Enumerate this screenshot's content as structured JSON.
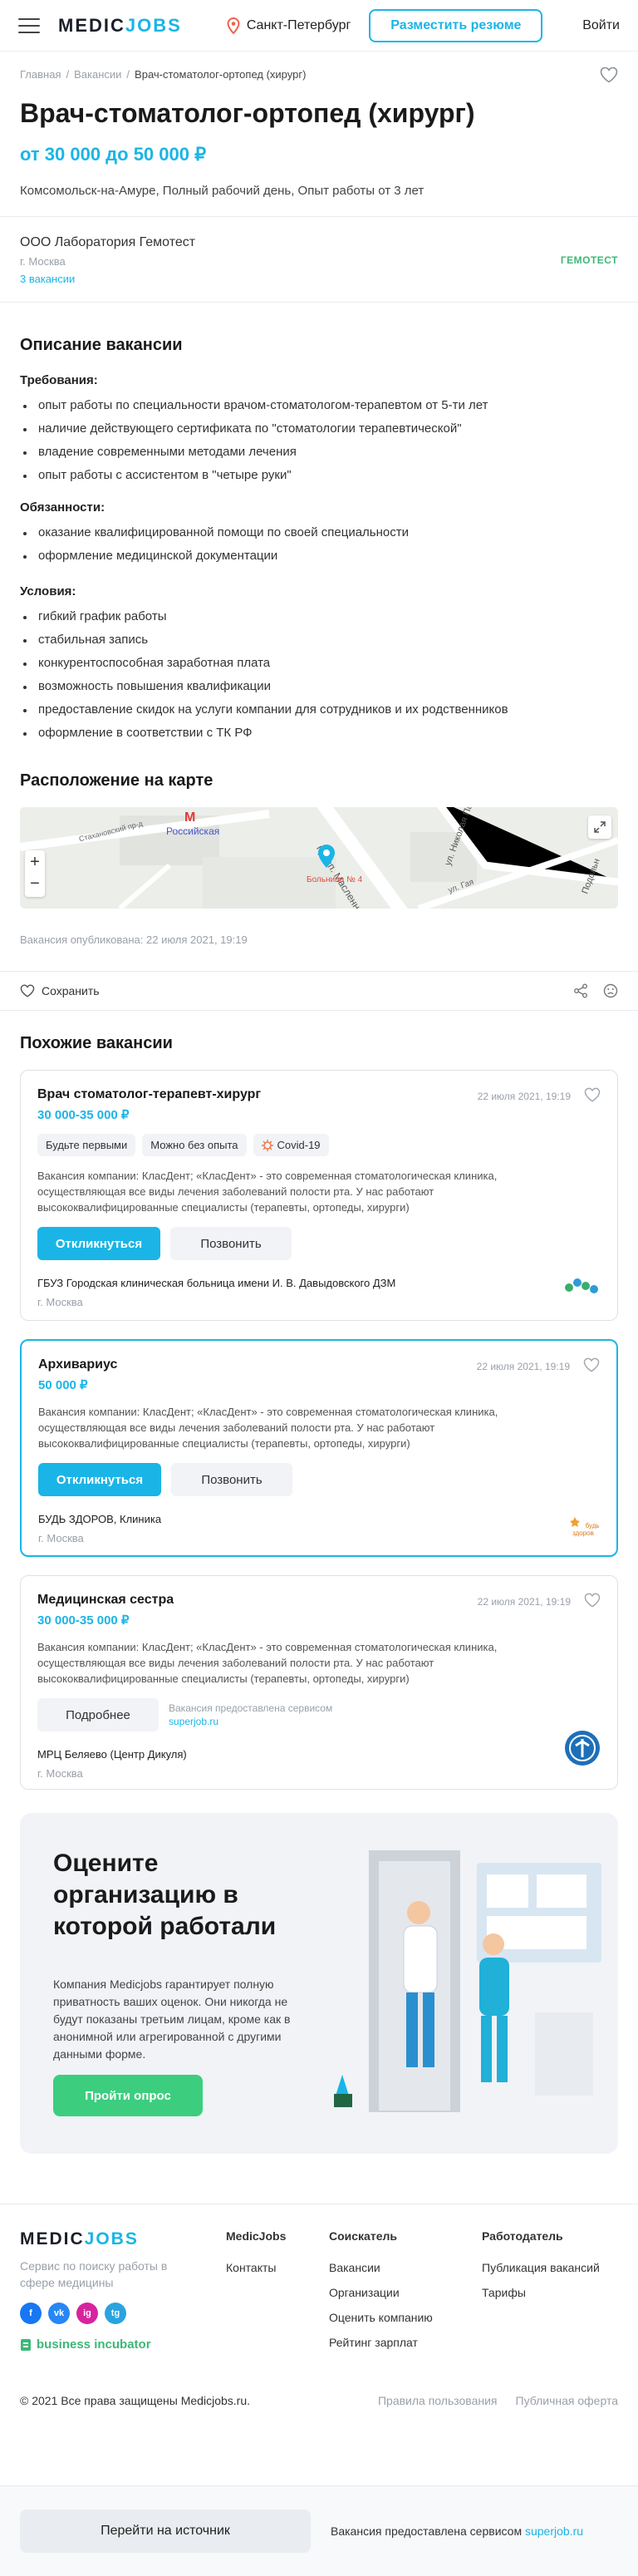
{
  "header": {
    "logo_a": "MEDIC",
    "logo_b": "JOBS",
    "city": "Санкт-Петербург",
    "resume_btn": "Разместить резюме",
    "login": "Войти"
  },
  "breadcrumbs": [
    "Главная",
    "Вакансии",
    "Врач-стоматолог-ортопед (хирург)"
  ],
  "vacancy": {
    "title": "Врач-стоматолог-ортопед (хирург)",
    "salary": "от 30 000 до 50 000 ₽",
    "meta": "Комсомольск-на-Амуре, Полный рабочий день, Опыт работы от 3 лет"
  },
  "company": {
    "name": "ООО Лаборатория Гемотест",
    "city": "г. Москва",
    "count": "3 вакансии",
    "logo_text": "ГЕМОТЕСТ"
  },
  "description": {
    "heading": "Описание вакансии",
    "req_heading": "Требования:",
    "requirements": [
      "опыт работы по специальности врачом-стоматологом-терапевтом от 5-ти лет",
      "наличие действующего сертификата по \"стоматологии терапевтической\"",
      "владение современными методами лечения",
      "опыт работы с ассистентом в \"четыре руки\""
    ],
    "duty_heading": "Обязанности:",
    "duties": [
      "оказание квалифицированной помощи по своей специальности",
      "оформление медицинской документации"
    ],
    "cond_heading": "Условия:",
    "conditions": [
      "гибкий график работы",
      "стабильная запись",
      "конкурентоспособная заработная плата",
      "возможность повышения квалификации",
      "предоставление скидок на услуги компании для сотрудников и их родственников",
      "оформление в соответствии с ТК РФ"
    ]
  },
  "map": {
    "heading": "Расположение на карте",
    "streets": [
      "Стахановский пр-д",
      "просп. Масленникова",
      "ул. Николая Панова",
      "ул. Гая",
      "Подольн"
    ],
    "metro": "Российская",
    "marker": "Больница № 4",
    "zoom_in": "+",
    "zoom_out": "−"
  },
  "published": "Вакансия опубликована: 22 июля 2021, 19:19",
  "save_label": "Сохранить",
  "similar": {
    "heading": "Похожие вакансии",
    "cards": [
      {
        "title": "Врач стоматолог-терапевт-хирург",
        "salary": "30 000-35 000 ₽",
        "date": "22 июля 2021, 19:19",
        "tags": [
          "Будьте первыми",
          "Можно без опыта",
          "Covid-19"
        ],
        "desc": "Вакансия компании: КласДент; «КласДент» - это современная стоматологическая клиника, осуществляющая все виды лечения заболеваний полости рта. У нас работают высококвалифицированные специалисты (терапевты, ортопеды, хирурги)",
        "primary": "Откликнуться",
        "secondary": "Позвонить",
        "org": "ГБУЗ Городская клиническая больница имени И. В. Давыдовского ДЗМ",
        "city": "г. Москва"
      },
      {
        "title": "Архивариус",
        "salary": "50 000 ₽",
        "date": "22 июля 2021, 19:19",
        "desc": "Вакансия компании: КласДент; «КласДент» - это современная стоматологическая клиника, осуществляющая все виды лечения заболеваний полости рта. У нас работают высококвалифицированные специалисты (терапевты, ортопеды, хирурги)",
        "primary": "Откликнуться",
        "secondary": "Позвонить",
        "org": "БУДЬ ЗДОРОВ, Клиника",
        "city": "г. Москва",
        "logo_text": "будь здоров"
      },
      {
        "title": "Медицинская сестра",
        "salary": "30 000-35 000 ₽",
        "date": "22 июля 2021, 19:19",
        "desc": "Вакансия компании: КласДент; «КласДент» - это современная стоматологическая клиника, осуществляющая все виды лечения заболеваний полости рта. У нас работают высококвалифицированные специалисты (терапевты, ортопеды, хирурги)",
        "secondary": "Подробнее",
        "source_a": "Вакансия предоставлена сервисом",
        "source_b": "superjob.ru",
        "org": "МРЦ Беляево (Центр Дикуля)",
        "city": "г. Москва"
      }
    ]
  },
  "survey": {
    "title": "Оцените организацию в которой работали",
    "text": "Компания Medicjobs гарантирует полную приватность ваших оценок. Они никогда не будут показаны третьим лицам, кроме как в анонимной или агрегированной с другими данными форме.",
    "button": "Пройти опрос"
  },
  "footer": {
    "slogan": "Сервис по поиску работы в сфере медицины",
    "socials": [
      "f",
      "vk",
      "ig",
      "tg"
    ],
    "incubator": "business incubator",
    "col1": {
      "h": "MedicJobs",
      "links": [
        "Контакты"
      ]
    },
    "col2": {
      "h": "Соискатель",
      "links": [
        "Вакансии",
        "Организации",
        "Оценить компанию",
        "Рейтинг зарплат"
      ]
    },
    "col3": {
      "h": "Работодатель",
      "links": [
        "Публикация вакансий",
        "Тарифы"
      ]
    },
    "copyright": "© 2021 Все права защищены Medicjobs.ru.",
    "privacy": "Правила пользования",
    "offer": "Публичная оферта"
  },
  "bottombar": {
    "button": "Перейти на источник",
    "note_a": "Вакансия предоставлена сервисом",
    "note_b": "superjob.ru"
  },
  "colors": {
    "accent": "#1ab5e6",
    "green": "#3cce7e"
  }
}
